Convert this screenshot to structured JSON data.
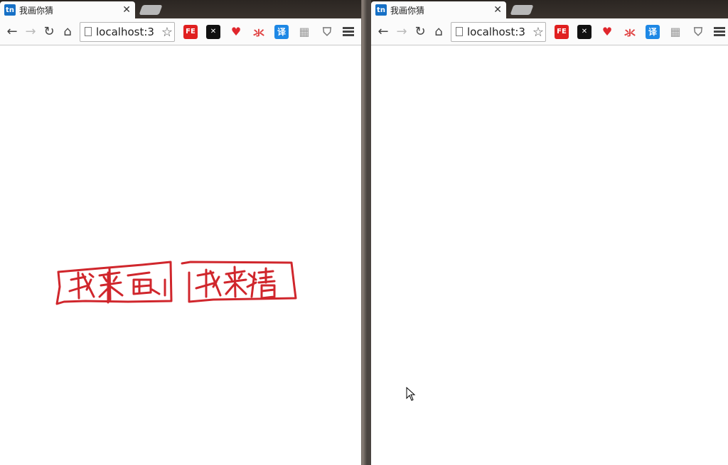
{
  "windows": [
    {
      "tab": {
        "favicon_text": "tn",
        "title": "我画你猜"
      },
      "omnibox": {
        "url": "localhost:3"
      }
    },
    {
      "tab": {
        "favicon_text": "tn",
        "title": "我画你猜"
      },
      "omnibox": {
        "url": "localhost:3"
      }
    }
  ],
  "extensions": [
    {
      "name": "fe-helper-icon",
      "text": "FE",
      "color": "#e02020"
    },
    {
      "name": "dark-extension-icon",
      "text": "✕",
      "color": "#111111"
    },
    {
      "name": "heart-icon",
      "text": "♥",
      "color": "#e0262c"
    },
    {
      "name": "weibo-icon",
      "text": "氺",
      "color": "#e04040"
    },
    {
      "name": "translate-icon",
      "text": "译",
      "color": "#1e88e5"
    },
    {
      "name": "reader-icon",
      "text": "▦",
      "color": "#9a9a9a"
    },
    {
      "name": "shield-icon",
      "text": "⛉",
      "color": "#777777"
    }
  ],
  "stroke_color": "#d0262c"
}
